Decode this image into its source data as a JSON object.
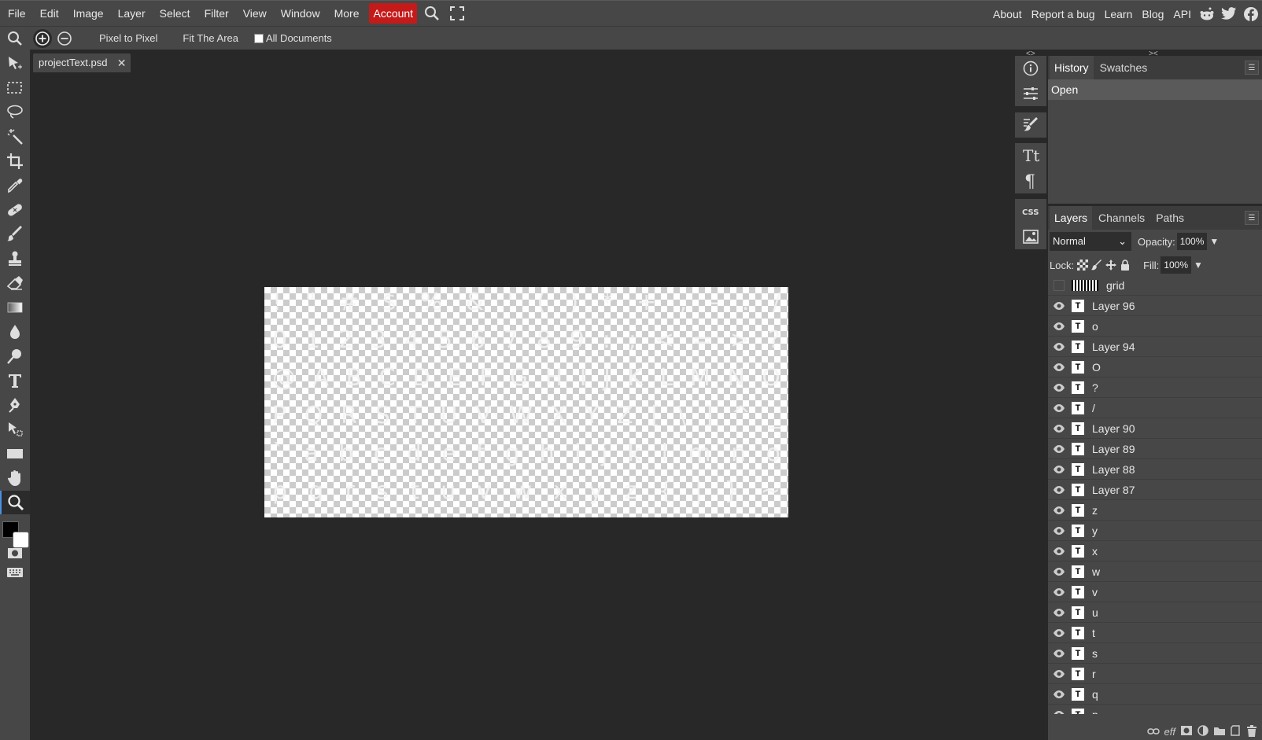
{
  "menubar": {
    "items": [
      "File",
      "Edit",
      "Image",
      "Layer",
      "Select",
      "Filter",
      "View",
      "Window",
      "More"
    ],
    "account": "Account",
    "right_items": [
      "About",
      "Report a bug",
      "Learn",
      "Blog",
      "API"
    ],
    "social_icons": [
      "reddit-icon",
      "twitter-icon",
      "facebook-icon"
    ],
    "account_color": "#c41a1a"
  },
  "optionbar": {
    "pixel_to_pixel": "Pixel to Pixel",
    "fit_area": "Fit The Area",
    "all_documents": "All Documents"
  },
  "document": {
    "tab_name": "projectText.psd",
    "canvas_rows": [
      [
        "!",
        "\"",
        "#",
        "$",
        "%",
        "&",
        "'",
        "(",
        ")",
        "*",
        "+",
        ",",
        "-",
        ".",
        "/"
      ],
      [
        "0",
        "1",
        "2",
        "3",
        "4",
        "5",
        "6",
        "7",
        "8",
        "9",
        ":",
        ";",
        "<",
        "=",
        ">",
        "?"
      ],
      [
        "@",
        "A",
        "B",
        "C",
        "D",
        "E",
        "F",
        "G",
        "H",
        "I",
        "J",
        "K",
        "L",
        "M",
        "N",
        "O"
      ],
      [
        "P",
        "Q",
        "R",
        "S",
        "T",
        "U",
        "V",
        "W",
        "X",
        "Y",
        "Z",
        "[",
        "\\",
        "]",
        "^",
        "_"
      ],
      [
        "`",
        "a",
        "b",
        "c",
        "d",
        "e",
        "f",
        "g",
        "h",
        "i",
        "j",
        "k",
        "l",
        "m",
        "n",
        "o"
      ],
      [
        "p",
        "q",
        "r",
        "s",
        "t",
        "u",
        "v",
        "w",
        "x",
        "y",
        "z",
        "{",
        "|",
        "}",
        "~"
      ]
    ]
  },
  "history": {
    "tabs": [
      "History",
      "Swatches"
    ],
    "entries": [
      "Open"
    ]
  },
  "layers": {
    "tabs": [
      "Layers",
      "Channels",
      "Paths"
    ],
    "blend_mode": "Normal",
    "opacity_label": "Opacity:",
    "opacity": "100%",
    "lock_label": "Lock:",
    "fill_label": "Fill:",
    "fill": "100%",
    "grid_layer": "grid",
    "items": [
      "Layer 96",
      "o",
      "Layer 94",
      "O",
      "?",
      "/",
      "Layer 90",
      "Layer 89",
      "Layer 88",
      "Layer 87",
      "z",
      "y",
      "x",
      "w",
      "v",
      "u",
      "t",
      "s",
      "r",
      "q",
      "p"
    ]
  },
  "footer": {
    "eff_label": "eff"
  }
}
